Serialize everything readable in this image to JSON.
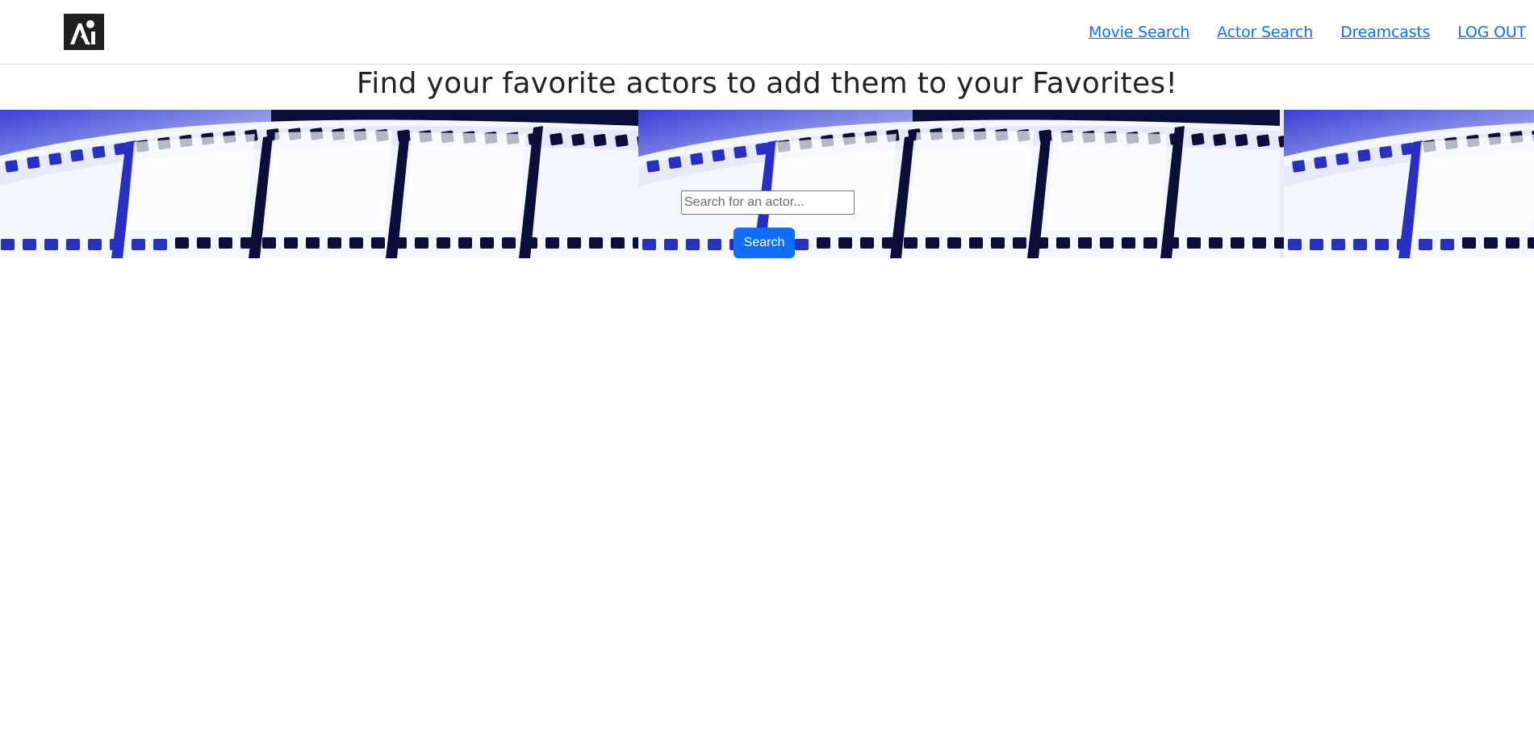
{
  "header": {
    "logo_alt": "A",
    "nav": [
      {
        "label": "Movie Search"
      },
      {
        "label": "Actor Search"
      },
      {
        "label": "Dreamcasts"
      },
      {
        "label": "LOG OUT"
      }
    ]
  },
  "main": {
    "headline": "Find your favorite actors to add them to your Favorites!",
    "search": {
      "placeholder": "Search for an actor...",
      "value": "",
      "button_label": "Search"
    }
  },
  "colors": {
    "link": "#0d6efd",
    "button": "#0d6efd",
    "film_blue": "#2a2fc4",
    "film_dark": "#0a0f3a"
  },
  "icons": {
    "logo": "site-logo-icon"
  }
}
